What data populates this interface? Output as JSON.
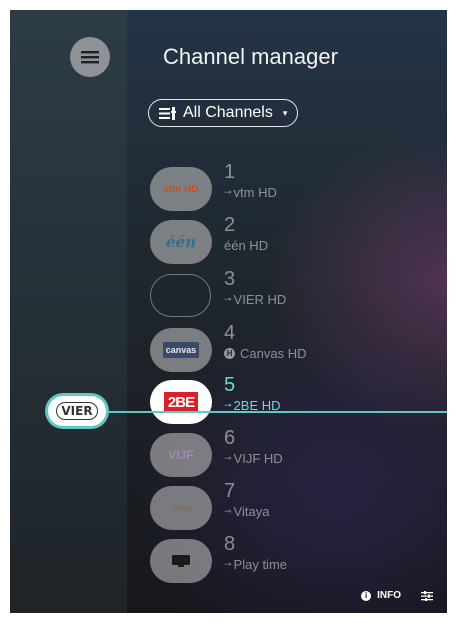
{
  "header": {
    "title": "Channel manager",
    "filter_label": "All Channels",
    "filter_icon": "list-settings-icon",
    "filter_caret": "▾"
  },
  "selection_bubble": {
    "logo_text": "VIER"
  },
  "channels": [
    {
      "number": "1",
      "name": "vtm HD",
      "status_icon": "key-icon",
      "logo_text": "vtm HD"
    },
    {
      "number": "2",
      "name": "één HD",
      "status_icon": "",
      "logo_text": "één"
    },
    {
      "number": "3",
      "name": "VIER HD",
      "status_icon": "key-icon",
      "logo_text": ""
    },
    {
      "number": "4",
      "name": "Canvas HD",
      "status_icon": "hd-icon",
      "logo_text": "canvas"
    },
    {
      "number": "5",
      "name": "2BE HD",
      "status_icon": "key-icon",
      "logo_text": "2BE"
    },
    {
      "number": "6",
      "name": "VIJF HD",
      "status_icon": "key-icon",
      "logo_text": "VIJF"
    },
    {
      "number": "7",
      "name": "Vitaya",
      "status_icon": "key-icon",
      "logo_text": "Vitaya"
    },
    {
      "number": "8",
      "name": "Play time",
      "status_icon": "key-icon",
      "logo_text": ""
    }
  ],
  "footer": {
    "info_label": "INFO",
    "info_icon_glyph": "i",
    "settings_icon": "sliders-icon"
  },
  "colors": {
    "accent": "#5fc8c3",
    "active_text": "#6fd7d4"
  }
}
